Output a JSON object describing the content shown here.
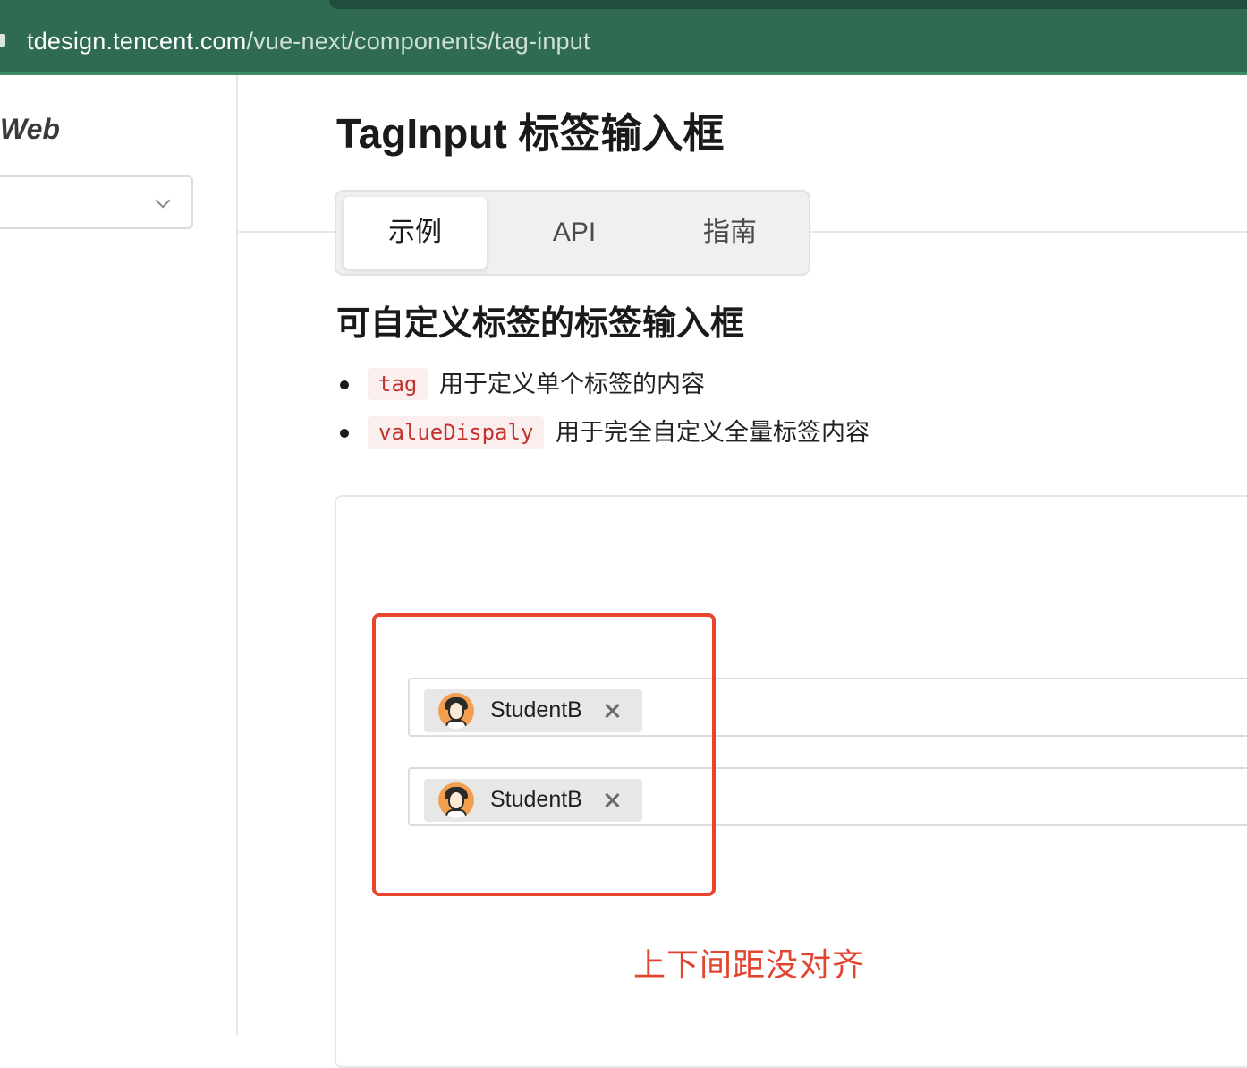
{
  "browser": {
    "url_host": "tdesign.tencent.com",
    "url_path": "/vue-next/components/tag-input"
  },
  "sidebar": {
    "brand": "Web",
    "version_select_value": ""
  },
  "page": {
    "title": "TagInput 标签输入框",
    "tabs": [
      {
        "label": "示例",
        "active": true
      },
      {
        "label": "API",
        "active": false
      },
      {
        "label": "指南",
        "active": false
      }
    ]
  },
  "section": {
    "title": "可自定义标签的标签输入框",
    "bullets": [
      {
        "code": "tag",
        "text": "用于定义单个标签的内容"
      },
      {
        "code": "valueDispaly",
        "text": "用于完全自定义全量标签内容"
      }
    ]
  },
  "demo": {
    "inputs": [
      {
        "tag_label": "StudentB"
      },
      {
        "tag_label": "StudentB"
      }
    ]
  },
  "annotation": {
    "text": "上下间距没对齐",
    "color": "#e8452c"
  }
}
